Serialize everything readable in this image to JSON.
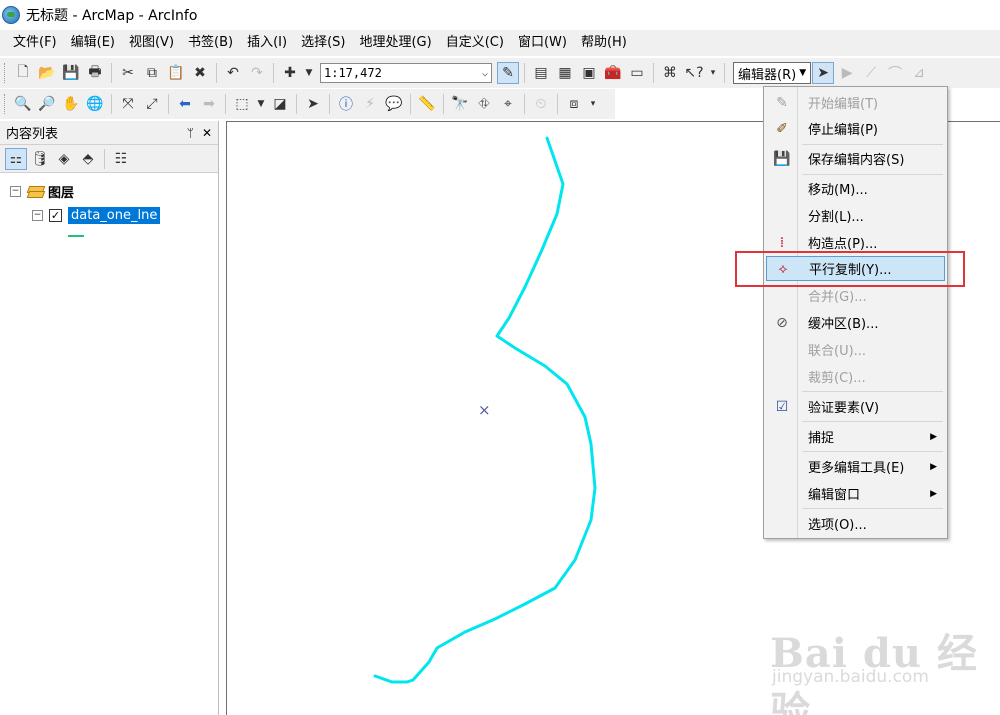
{
  "window": {
    "title": "无标题 - ArcMap - ArcInfo"
  },
  "menubar": {
    "items": [
      "文件(F)",
      "编辑(E)",
      "视图(V)",
      "书签(B)",
      "插入(I)",
      "选择(S)",
      "地理处理(G)",
      "自定义(C)",
      "窗口(W)",
      "帮助(H)"
    ]
  },
  "toolbar": {
    "scale_value": "1:17,472",
    "editor_dropdown": "编辑器(R)"
  },
  "toc": {
    "title": "内容列表",
    "pin": "ᛘ",
    "close": "✕",
    "layers_group": "图层",
    "layer_name": "data_one_lne",
    "expander_minus": "⊟",
    "check": "✓"
  },
  "editor_menu": {
    "items": [
      {
        "label": "开始编辑(T)",
        "enabled": false
      },
      {
        "label": "停止编辑(P)",
        "enabled": true
      },
      {
        "label": "保存编辑内容(S)",
        "enabled": true
      },
      {
        "label": "移动(M)...",
        "enabled": true
      },
      {
        "label": "分割(L)...",
        "enabled": true
      },
      {
        "label": "构造点(P)...",
        "enabled": true
      },
      {
        "label": "平行复制(Y)...",
        "enabled": true,
        "hovered": true
      },
      {
        "label": "合并(G)...",
        "enabled": false
      },
      {
        "label": "缓冲区(B)...",
        "enabled": true
      },
      {
        "label": "联合(U)...",
        "enabled": false
      },
      {
        "label": "裁剪(C)...",
        "enabled": false
      },
      {
        "label": "验证要素(V)",
        "enabled": true
      },
      {
        "label": "捕捉",
        "enabled": true,
        "submenu": true
      },
      {
        "label": "更多编辑工具(E)",
        "enabled": true,
        "submenu": true
      },
      {
        "label": "编辑窗口",
        "enabled": true,
        "submenu": true
      },
      {
        "label": "选项(O)...",
        "enabled": true
      }
    ]
  },
  "map": {
    "line_color": "#00e5ee",
    "center_marker": "×"
  },
  "watermark": {
    "text": "Bai du 经验",
    "sub": "jingyan.baidu.com"
  },
  "colors": {
    "highlight": "#e0343c",
    "menu_hover": "#cde6f7",
    "selection": "#0078d7"
  }
}
